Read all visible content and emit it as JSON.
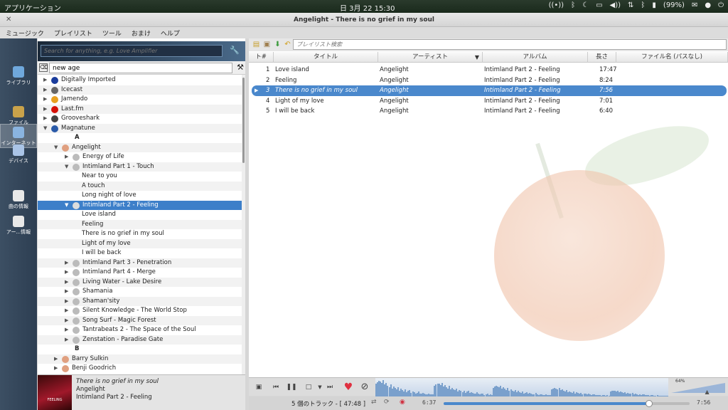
{
  "system_bar": {
    "apps": "アプリケーション",
    "clock": "日 3月 22 15:30",
    "battery": "(99%)"
  },
  "window": {
    "title": "Angelight - There is no grief in my soul"
  },
  "menu": [
    "ミュージック",
    "プレイリスト",
    "ツール",
    "おまけ",
    "ヘルプ"
  ],
  "tabs": [
    {
      "label": "ライブラリ",
      "icon": "library-icon",
      "color": "#6fa8dc",
      "active": false
    },
    {
      "label": "ファイル",
      "icon": "folder-icon",
      "color": "#c9a24a",
      "active": false
    },
    {
      "label": "インターネット",
      "icon": "globe-icon",
      "color": "#8ab4e0",
      "active": true
    },
    {
      "label": "デバイス",
      "icon": "device-icon",
      "color": "#aac4e6",
      "active": false
    },
    {
      "label": "曲の情報",
      "icon": "song-info-icon",
      "color": "#e8e8e8",
      "active": false
    },
    {
      "label": "アー...情報",
      "icon": "artist-info-icon",
      "color": "#e8e8e8",
      "active": false
    }
  ],
  "global_search": {
    "placeholder": "Search for anything, e.g. Love Amplifier"
  },
  "filter": {
    "value": "new age"
  },
  "tree": [
    {
      "label": "Digitally Imported",
      "depth": 0,
      "arrow": "▶",
      "icon": "di-icon",
      "icolor": "#1a3c9c"
    },
    {
      "label": "Icecast",
      "depth": 0,
      "arrow": "▶",
      "icon": "radio-icon",
      "icolor": "#666"
    },
    {
      "label": "Jamendo",
      "depth": 0,
      "arrow": "▶",
      "icon": "jamendo-icon",
      "icolor": "#e8a020"
    },
    {
      "label": "Last.fm",
      "depth": 0,
      "arrow": "▶",
      "icon": "lastfm-icon",
      "icolor": "#d51007"
    },
    {
      "label": "Grooveshark",
      "depth": 0,
      "arrow": "▶",
      "icon": "grooveshark-icon",
      "icolor": "#444"
    },
    {
      "label": "Magnatune",
      "depth": 0,
      "arrow": "▼",
      "icon": "magnatune-icon",
      "icolor": "#2a5aa8"
    },
    {
      "label": "A",
      "depth": 0,
      "letter": true
    },
    {
      "label": "Angelight",
      "depth": 1,
      "arrow": "▼",
      "icon": "artist-icon",
      "icolor": "#e0a080"
    },
    {
      "label": "Energy of Life",
      "depth": 2,
      "arrow": "▶",
      "icon": "disc-icon",
      "icolor": "#bbb"
    },
    {
      "label": "Intimland Part 1 - Touch",
      "depth": 2,
      "arrow": "▼",
      "icon": "disc-icon",
      "icolor": "#bbb"
    },
    {
      "label": "Near to you",
      "depth": 3
    },
    {
      "label": "A touch",
      "depth": 3
    },
    {
      "label": "Long night of love",
      "depth": 3
    },
    {
      "label": "Intimland Part 2 - Feeling",
      "depth": 2,
      "arrow": "▼",
      "icon": "disc-icon",
      "icolor": "#ddd",
      "selected": true
    },
    {
      "label": "Love island",
      "depth": 3
    },
    {
      "label": "Feeling",
      "depth": 3
    },
    {
      "label": "There is no grief in my soul",
      "depth": 3
    },
    {
      "label": "Light of my love",
      "depth": 3
    },
    {
      "label": "I will be back",
      "depth": 3
    },
    {
      "label": "Intimland Part 3 - Penetration",
      "depth": 2,
      "arrow": "▶",
      "icon": "disc-icon",
      "icolor": "#bbb"
    },
    {
      "label": "Intimland Part 4 - Merge",
      "depth": 2,
      "arrow": "▶",
      "icon": "disc-icon",
      "icolor": "#bbb"
    },
    {
      "label": "Living Water - Lake Desire",
      "depth": 2,
      "arrow": "▶",
      "icon": "disc-icon",
      "icolor": "#bbb"
    },
    {
      "label": "Shamania",
      "depth": 2,
      "arrow": "▶",
      "icon": "disc-icon",
      "icolor": "#bbb"
    },
    {
      "label": "Shaman'sity",
      "depth": 2,
      "arrow": "▶",
      "icon": "disc-icon",
      "icolor": "#bbb"
    },
    {
      "label": "Silent Knowledge - The World Stop",
      "depth": 2,
      "arrow": "▶",
      "icon": "disc-icon",
      "icolor": "#bbb"
    },
    {
      "label": "Song Surf - Magic Forest",
      "depth": 2,
      "arrow": "▶",
      "icon": "disc-icon",
      "icolor": "#bbb"
    },
    {
      "label": "Tantrabeats 2 - The Space of the Soul",
      "depth": 2,
      "arrow": "▶",
      "icon": "disc-icon",
      "icolor": "#bbb"
    },
    {
      "label": "Zenstation - Paradise Gate",
      "depth": 2,
      "arrow": "▶",
      "icon": "disc-icon",
      "icolor": "#bbb"
    },
    {
      "label": "B",
      "depth": 0,
      "letter": true
    },
    {
      "label": "Barry Sulkin",
      "depth": 1,
      "arrow": "▶",
      "icon": "artist-icon",
      "icolor": "#e0a080"
    },
    {
      "label": "Benji Goodrich",
      "depth": 1,
      "arrow": "▶",
      "icon": "artist-icon",
      "icolor": "#e0a080"
    }
  ],
  "now_playing": {
    "title": "There is no grief in my soul",
    "artist": "Angelight",
    "album": "Intimland Part 2 - Feeling",
    "cover_text": "FEELING"
  },
  "playlist_search": {
    "placeholder": "プレイリスト検索"
  },
  "columns": [
    "ト#",
    "タイトル",
    "アーティスト",
    "アルバム",
    "長さ",
    "ファイル名 (パスなし)"
  ],
  "tracks": [
    {
      "num": "1",
      "title": "Love island",
      "artist": "Angelight",
      "album": "Intimland Part 2 - Feeling",
      "length": "17:47"
    },
    {
      "num": "2",
      "title": "Feeling",
      "artist": "Angelight",
      "album": "Intimland Part 2 - Feeling",
      "length": "8:24"
    },
    {
      "num": "3",
      "title": "There is no grief in my soul",
      "artist": "Angelight",
      "album": "Intimland Part 2 - Feeling",
      "length": "7:56",
      "current": true
    },
    {
      "num": "4",
      "title": "Light of my love",
      "artist": "Angelight",
      "album": "Intimland Part 2 - Feeling",
      "length": "7:01"
    },
    {
      "num": "5",
      "title": "I will be back",
      "artist": "Angelight",
      "album": "Intimland Part 2 - Feeling",
      "length": "6:40"
    }
  ],
  "status": {
    "info": "5 個のトラック - [ 47:48 ]",
    "elapsed": "6:37",
    "total": "7:56",
    "progress": 0.834,
    "volume_label": "64%",
    "volume": 0.64
  },
  "colors": {
    "accent": "#3d7fc9",
    "love": "#e03040"
  }
}
